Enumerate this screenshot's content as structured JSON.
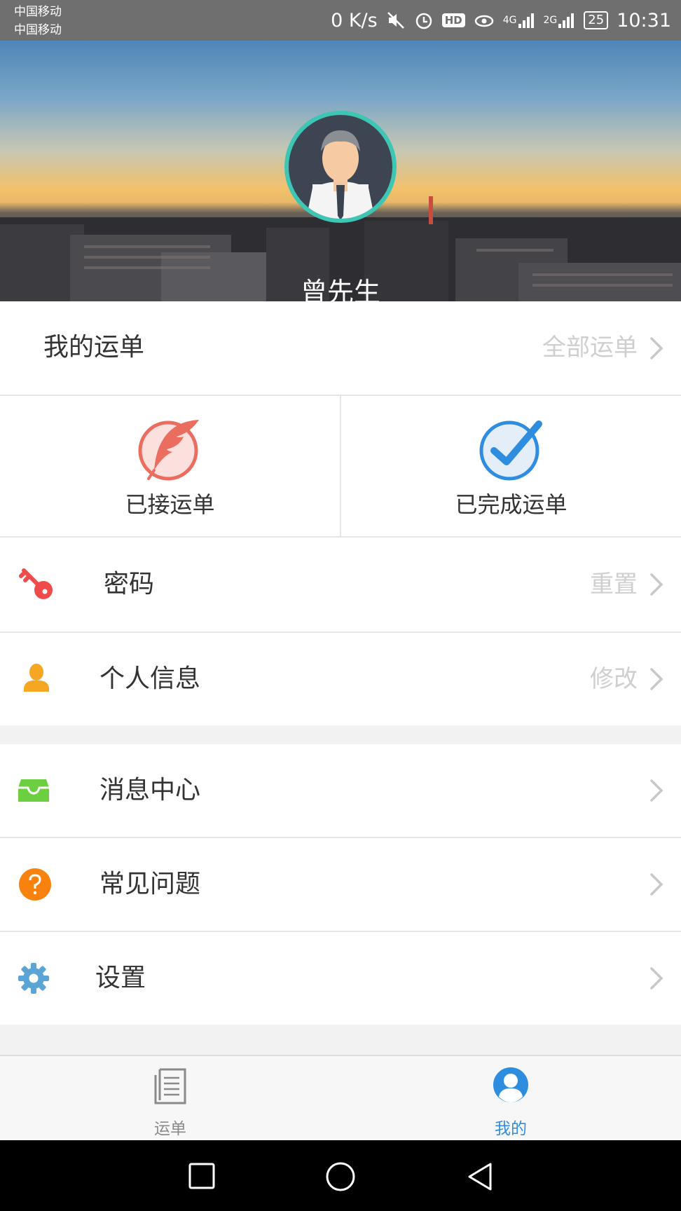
{
  "status_bar": {
    "carrier_1": "中国移动",
    "carrier_2": "中国移动",
    "speed": "0 K/s",
    "hd": "HD",
    "net_4g": "4G",
    "net_2g": "2G",
    "battery": "25",
    "time": "10:31"
  },
  "profile": {
    "username": "曾先生"
  },
  "orders": {
    "title": "我的运单",
    "all_link": "全部运单",
    "accepted_label": "已接运单",
    "completed_label": "已完成运单"
  },
  "menu_group_1": [
    {
      "label": "密码",
      "action": "重置",
      "icon": "key-icon"
    },
    {
      "label": "个人信息",
      "action": "修改",
      "icon": "person-icon"
    }
  ],
  "menu_group_2": [
    {
      "label": "消息中心",
      "icon": "inbox-icon"
    },
    {
      "label": "常见问题",
      "icon": "question-icon"
    },
    {
      "label": "设置",
      "icon": "gear-icon"
    }
  ],
  "tabbar": {
    "tabs": [
      {
        "label": "运单",
        "icon": "document-icon",
        "active": false
      },
      {
        "label": "我的",
        "icon": "user-icon",
        "active": true
      }
    ],
    "active_color": "#2f8ddf",
    "inactive_color": "#8a8a8a"
  },
  "colors": {
    "key": "#ef4b4b",
    "person": "#f5a623",
    "inbox": "#6ccf3f",
    "question": "#f7830e",
    "gear": "#5aa5d6",
    "accepted": "#ea6d5f",
    "completed": "#2f8ddf"
  }
}
